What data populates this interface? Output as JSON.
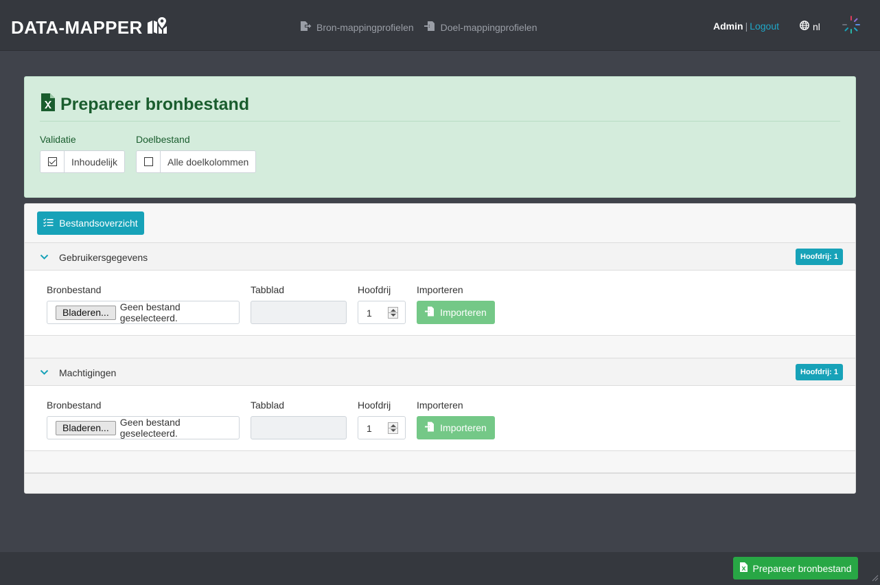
{
  "brand": {
    "name": "DATA-MAPPER",
    "icon": "map-icon"
  },
  "nav": {
    "links": [
      {
        "label": "Bron-mappingprofielen",
        "icon": "file-export-icon"
      },
      {
        "label": "Doel-mappingprofielen",
        "icon": "file-import-icon"
      }
    ],
    "user": "Admin",
    "separator": "|",
    "logout": "Logout",
    "lang": "nl",
    "lang_icon": "globe-icon"
  },
  "prepare": {
    "title": "Prepareer bronbestand",
    "title_icon": "excel-file-icon",
    "options": [
      {
        "group_label": "Validatie",
        "text": "Inhoudelijk",
        "checked": true
      },
      {
        "group_label": "Doelbestand",
        "text": "Alle doelkolommen",
        "checked": false
      }
    ]
  },
  "overview_button": "Bestandsoverzicht",
  "sections": [
    {
      "title": "Gebruikersgegevens",
      "badge": "Hoofdrij: 1",
      "labels": {
        "file": "Bronbestand",
        "sheet": "Tabblad",
        "header_row": "Hoofdrij",
        "import": "Importeren"
      },
      "browse_label": "Bladeren...",
      "no_file": "Geen bestand geselecteerd.",
      "sheet_value": "",
      "header_row_value": "1",
      "import_button": "Importeren"
    },
    {
      "title": "Machtigingen",
      "badge": "Hoofdrij: 1",
      "labels": {
        "file": "Bronbestand",
        "sheet": "Tabblad",
        "header_row": "Hoofdrij",
        "import": "Importeren"
      },
      "browse_label": "Bladeren...",
      "no_file": "Geen bestand geselecteerd.",
      "sheet_value": "",
      "header_row_value": "1",
      "import_button": "Importeren"
    }
  ],
  "footer": {
    "prepare_button": "Prepareer bronbestand"
  },
  "colors": {
    "accent": "#17a2b8",
    "success": "#28a745",
    "success_light": "#74c887",
    "navbar": "#35383e",
    "background": "#40434b",
    "prepare_bg": "#d4ecdc",
    "prepare_text": "#1a5d2e"
  }
}
